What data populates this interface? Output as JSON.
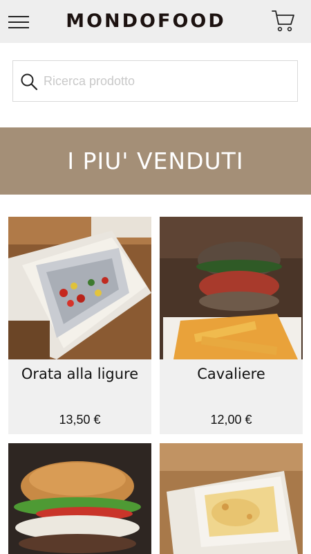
{
  "header": {
    "brand": "MONDOFOOD",
    "menu_icon": "hamburger-menu-icon",
    "cart_icon": "shopping-cart-icon",
    "background": "#eeeeee"
  },
  "search": {
    "placeholder": "Ricerca prodotto",
    "value": "",
    "icon": "search-icon"
  },
  "banner": {
    "title": "I PIU' VENDUTI",
    "background": "#a48f77"
  },
  "products": [
    {
      "name": "Orata alla ligure",
      "price": "13,50 €",
      "image": "foil-baked-fish-in-takeaway-box"
    },
    {
      "name": "Cavaliere",
      "price": "12,00 €",
      "image": "burger-with-fries"
    },
    {
      "name": "",
      "price": "",
      "image": "cheeseburger-with-lettuce-and-tomato"
    },
    {
      "name": "",
      "price": "",
      "image": "lasagna-in-takeaway-box"
    }
  ]
}
